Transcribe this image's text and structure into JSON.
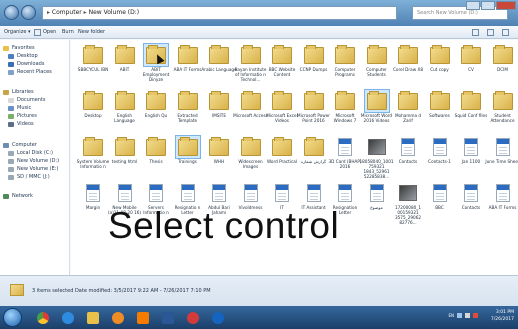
{
  "address": {
    "root": "Computer",
    "drive": "New Volume (D:)"
  },
  "search": {
    "placeholder": "Search New Volume (D:)"
  },
  "toolbar": {
    "organize": "Organize ▾",
    "open": "Open",
    "burn": "Burn",
    "new_folder": "New folder"
  },
  "sidebar": {
    "favorites": {
      "title": "Favorites",
      "items": [
        "Desktop",
        "Downloads",
        "Recent Places"
      ]
    },
    "libraries": {
      "title": "Libraries",
      "items": [
        "Documents",
        "Music",
        "Pictures",
        "Videos"
      ]
    },
    "computer": {
      "title": "Computer",
      "items": [
        "Local Disk (C:)",
        "New Volume (D:)",
        "New Volume (E:)",
        "SD / MMC (J:)"
      ]
    },
    "network": {
      "title": "Network"
    }
  },
  "items": [
    {
      "label": "SBBCYCUL IBN",
      "kind": "folder"
    },
    {
      "label": "ABIT",
      "kind": "folder"
    },
    {
      "label": "ABIT Employment Dinyze",
      "kind": "folder",
      "selected": true
    },
    {
      "label": "ABA IT Forms",
      "kind": "folder"
    },
    {
      "label": "Arabic Language",
      "kind": "folder"
    },
    {
      "label": "Bayan Institute of Informatio n Technol...",
      "kind": "folder"
    },
    {
      "label": "BBC Website Content",
      "kind": "folder"
    },
    {
      "label": "CCNP Dumps",
      "kind": "folder"
    },
    {
      "label": "Computer Programs",
      "kind": "folder"
    },
    {
      "label": "Computer Students",
      "kind": "folder"
    },
    {
      "label": "Corel Draw X8",
      "kind": "folder"
    },
    {
      "label": "Cut copy",
      "kind": "folder"
    },
    {
      "label": "CV",
      "kind": "folder"
    },
    {
      "label": "DCIM",
      "kind": "folder"
    },
    {
      "label": "Desktop",
      "kind": "folder"
    },
    {
      "label": "English Language",
      "kind": "folder"
    },
    {
      "label": "English Qu",
      "kind": "folder"
    },
    {
      "label": "Extracted Template",
      "kind": "folder"
    },
    {
      "label": "IMSITE",
      "kind": "folder"
    },
    {
      "label": "Microsoft Access",
      "kind": "folder"
    },
    {
      "label": "Microsoft Excel Videos",
      "kind": "folder"
    },
    {
      "label": "Microsoft Power Point 2016",
      "kind": "folder"
    },
    {
      "label": "Microsoft Windows 7",
      "kind": "folder"
    },
    {
      "label": "Microsoft Word 2016 Videos",
      "kind": "folder",
      "selected": true
    },
    {
      "label": "Mohamma d Zarif",
      "kind": "folder"
    },
    {
      "label": "Softwares",
      "kind": "folder"
    },
    {
      "label": "Squid Conf files",
      "kind": "folder"
    },
    {
      "label": "Student Attendance",
      "kind": "folder"
    },
    {
      "label": "System Volume Informatio n",
      "kind": "folder"
    },
    {
      "label": "testing html",
      "kind": "folder"
    },
    {
      "label": "Thesis",
      "kind": "folder"
    },
    {
      "label": "Trainings",
      "kind": "folder",
      "selected": true
    },
    {
      "label": "WHH",
      "kind": "folder"
    },
    {
      "label": "Widescreen Images",
      "kind": "folder"
    },
    {
      "label": "Word Practical",
      "kind": "folder"
    },
    {
      "label": "گزارش شماره",
      "kind": "folder"
    },
    {
      "label": "3D Card (BHAP) 2016",
      "kind": "doc"
    },
    {
      "label": "18058040_1001759321 1843_52961 52285838...",
      "kind": "image"
    },
    {
      "label": "Contacts",
      "kind": "doc"
    },
    {
      "label": "Contacts-1",
      "kind": "doc"
    },
    {
      "label": "Jan 1100",
      "kind": "doc"
    },
    {
      "label": "June Time Sheet",
      "kind": "doc"
    },
    {
      "label": "Margin",
      "kind": "doc"
    },
    {
      "label": "New Mobile (a)11-08-20 16)",
      "kind": "doc"
    },
    {
      "label": "Servers Informatio n",
      "kind": "doc"
    },
    {
      "label": "Resignatio n Letter",
      "kind": "doc"
    },
    {
      "label": "Abdul Bari Jahami",
      "kind": "doc"
    },
    {
      "label": "Vivoldmess",
      "kind": "doc"
    },
    {
      "label": "IT",
      "kind": "doc"
    },
    {
      "label": "IT Assistant",
      "kind": "doc"
    },
    {
      "label": "Resignation Letter",
      "kind": "doc"
    },
    {
      "label": "موضوع",
      "kind": "doc"
    },
    {
      "label": "17200080_1 00159321 3575_29062 82776...",
      "kind": "image"
    },
    {
      "label": "BBC",
      "kind": "doc"
    },
    {
      "label": "Contacts",
      "kind": "doc"
    },
    {
      "label": "ABA IT Forms",
      "kind": "doc"
    }
  ],
  "overlay_caption": "Select control",
  "status": {
    "text": "3 items selected  Date modified: 3/5/2017 9:22 AM - 7/26/2017 7:10 PM"
  },
  "tray": {
    "lang": "EN",
    "time": "3:01 PM",
    "date": "7/26/2017"
  },
  "taskbar_apps": [
    "chrome",
    "ie",
    "explorer",
    "media",
    "vlc",
    "word",
    "paint",
    "teamviewer"
  ]
}
